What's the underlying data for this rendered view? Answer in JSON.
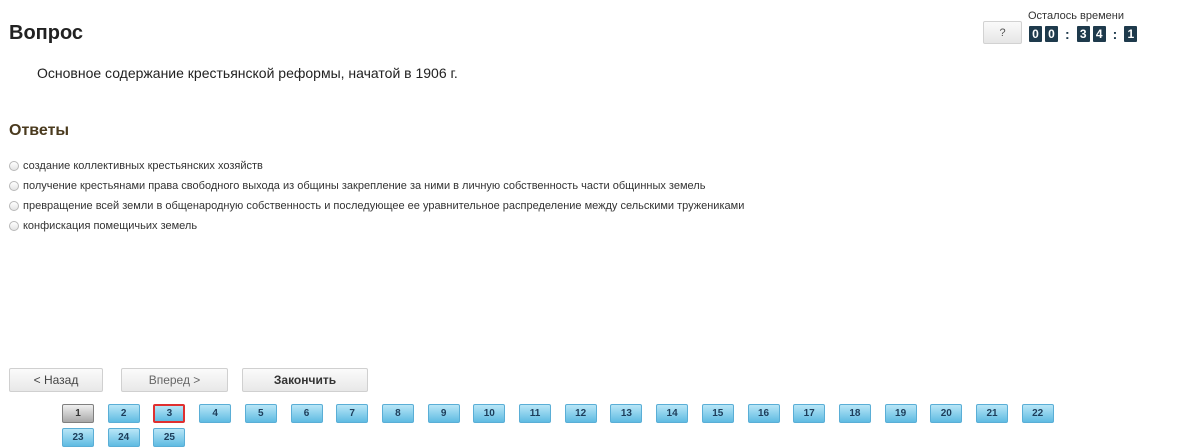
{
  "question": {
    "title": "Вопрос",
    "text": "Основное содержание крестьянской реформы, начатой в 1906 г."
  },
  "answers": {
    "title": "Ответы",
    "options": [
      "создание коллективных крестьянских хозяйств",
      "получение крестьянами права свободного выхода из общины закрепление за ними в личную собственность части общинных земель",
      "превращение всей земли в общенародную собственность и последующее ее уравнительное распределение между сельскими тружениками",
      "конфискация помещичьих земель"
    ]
  },
  "help_button": "?",
  "timer": {
    "label": "Осталось времени",
    "digits": [
      "0",
      "0",
      "3",
      "4",
      "1"
    ],
    "separator": ":"
  },
  "nav": {
    "back": "< Назад",
    "next": "Вперед >",
    "finish": "Закончить"
  },
  "pages": [
    "1",
    "2",
    "3",
    "4",
    "5",
    "6",
    "7",
    "8",
    "9",
    "10",
    "11",
    "12",
    "13",
    "14",
    "15",
    "16",
    "17",
    "18",
    "19",
    "20",
    "21",
    "22",
    "23",
    "24",
    "25"
  ],
  "current_page": "1",
  "marked_page": "3"
}
